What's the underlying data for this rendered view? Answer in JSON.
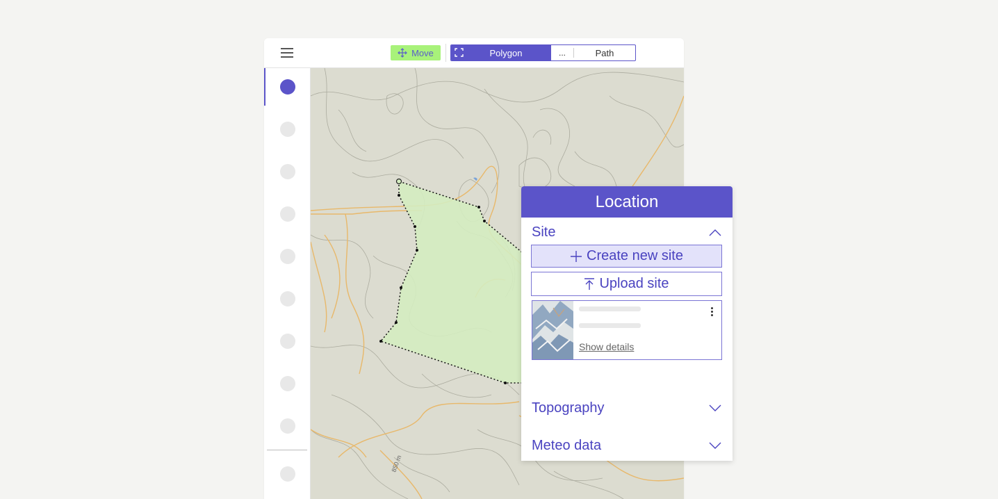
{
  "toolbar": {
    "move_label": "Move",
    "modes": {
      "polygon_label": "Polygon",
      "more_label": "...",
      "path_label": "Path",
      "selected": "Polygon"
    }
  },
  "sidebar": {
    "items": [
      {
        "icon": "circle-icon",
        "active": true
      },
      {
        "icon": "circle-icon",
        "active": false
      },
      {
        "icon": "circle-icon",
        "active": false
      },
      {
        "icon": "circle-icon",
        "active": false
      },
      {
        "icon": "circle-icon",
        "active": false
      },
      {
        "icon": "circle-icon",
        "active": false
      },
      {
        "icon": "circle-icon",
        "active": false
      },
      {
        "icon": "circle-icon",
        "active": false
      },
      {
        "icon": "circle-icon",
        "active": false
      },
      {
        "icon": "circle-icon",
        "active": false
      }
    ]
  },
  "map": {
    "contour_label": "850 m"
  },
  "panel": {
    "title": "Location",
    "site": {
      "title": "Site",
      "expanded": true,
      "create_label": "Create new site",
      "upload_label": "Upload site",
      "card": {
        "show_details_label": "Show details"
      }
    },
    "topography": {
      "title": "Topography",
      "expanded": false
    },
    "meteo": {
      "title": "Meteo data",
      "expanded": false
    }
  },
  "colors": {
    "accent": "#5b54c9",
    "move_highlight": "#a8f27a",
    "polygon_fill": "#d4ecc0",
    "map_background": "#dcdcd0",
    "road": "#e8b86a"
  }
}
